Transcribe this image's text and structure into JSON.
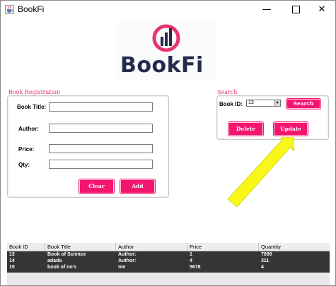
{
  "window": {
    "title": "BookFi",
    "min_glyph": "—",
    "close_glyph": "✕"
  },
  "logo": {
    "text": "BookFi",
    "colors": {
      "ring": "#e8336f",
      "bars": "#262b4d",
      "text": "#262b4d"
    }
  },
  "registration": {
    "section_title": "Book Registration",
    "fields": [
      {
        "label": "Book Title:",
        "value": ""
      },
      {
        "label": "Author:",
        "value": ""
      },
      {
        "label": "Price:",
        "value": ""
      },
      {
        "label": "Qty:",
        "value": ""
      }
    ],
    "clear_label": "Clear",
    "add_label": "Add"
  },
  "search": {
    "section_title": "Search",
    "book_id_label": "Book ID:",
    "selected_id": "13",
    "search_label": "Search",
    "delete_label": "Delete",
    "update_label": "Update"
  },
  "table": {
    "columns": [
      "Book ID",
      "Book Title",
      "Author",
      "Price",
      "Quantity"
    ],
    "rows": [
      [
        "13",
        "Book of Science",
        "Author:",
        "1",
        "7999"
      ],
      [
        "14",
        "adada",
        "Author:",
        "4",
        "311"
      ],
      [
        "15",
        "book of no's",
        "me",
        "5678",
        "4"
      ]
    ]
  },
  "colors": {
    "accent": "#f2166f",
    "section_label": "#e0326f",
    "arrow": "#f7f71a",
    "table_body": "#353535"
  }
}
